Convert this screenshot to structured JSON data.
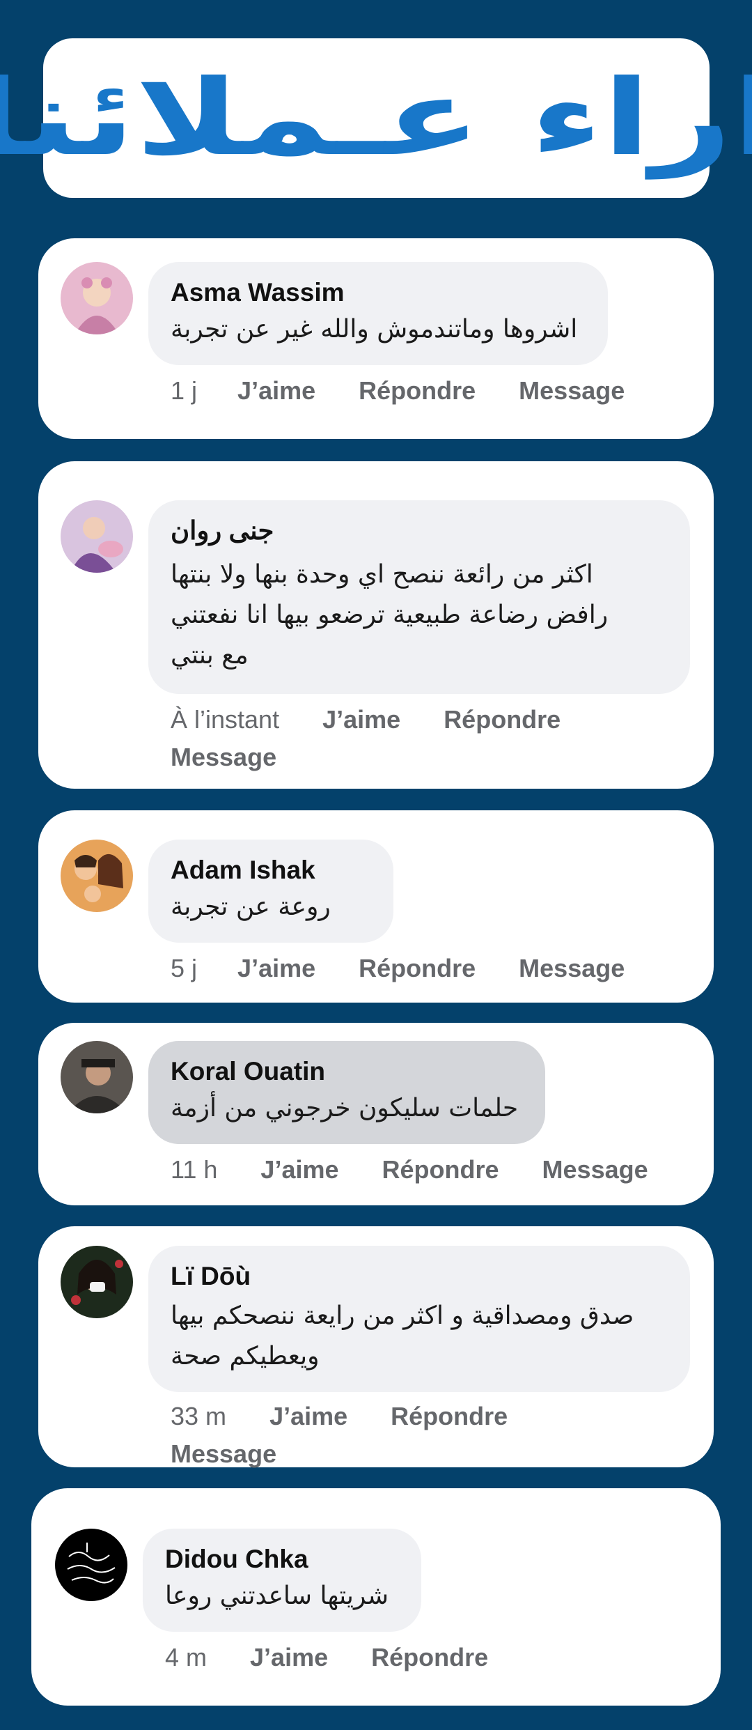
{
  "title": "اراء عـملائنا",
  "comments": [
    {
      "name": "Asma Wassim",
      "lines": [
        "اشروها وماتندموش والله غير عن تجربة"
      ],
      "time": "1 j",
      "like": "J’aime",
      "reply": "Répondre",
      "message": "Message"
    },
    {
      "name": "جنى روان",
      "lines": [
        "اكثر من رائعة  ننصح اي وحدة بنها ولا بنتها",
        "رافض  رضاعة طبيعية ترضعو بيها انا نفعتني",
        "مع بنتي"
      ],
      "time": "À l’instant",
      "like": "J’aime",
      "reply": "Répondre",
      "message": "Message"
    },
    {
      "name": "Adam Ishak",
      "lines": [
        "روعة عن تجربة"
      ],
      "time": "5 j",
      "like": "J’aime",
      "reply": "Répondre",
      "message": "Message"
    },
    {
      "name": "Koral Ouatin",
      "lines": [
        "حلمات سليكون خرجوني من أزمة"
      ],
      "time": "11 h",
      "like": "J’aime",
      "reply": "Répondre",
      "message": "Message"
    },
    {
      "name": "Lï Dōù",
      "lines": [
        "صدق ومصداقية و اكثر من رايعة ننصحكم بيها",
        "ويعطيكم صحة"
      ],
      "time": "33 m",
      "like": "J’aime",
      "reply": "Répondre",
      "message": "Message"
    },
    {
      "name": "Didou Chka",
      "lines": [
        "شريتها ساعدتني روعا"
      ],
      "time": "4 m",
      "like": "J’aime",
      "reply": "Répondre"
    }
  ],
  "colors": {
    "background": "#04416b",
    "title": "#1877c9",
    "bubble": "#f0f1f4",
    "bubble_highlight": "#d4d6da",
    "action_text": "#65676b"
  }
}
